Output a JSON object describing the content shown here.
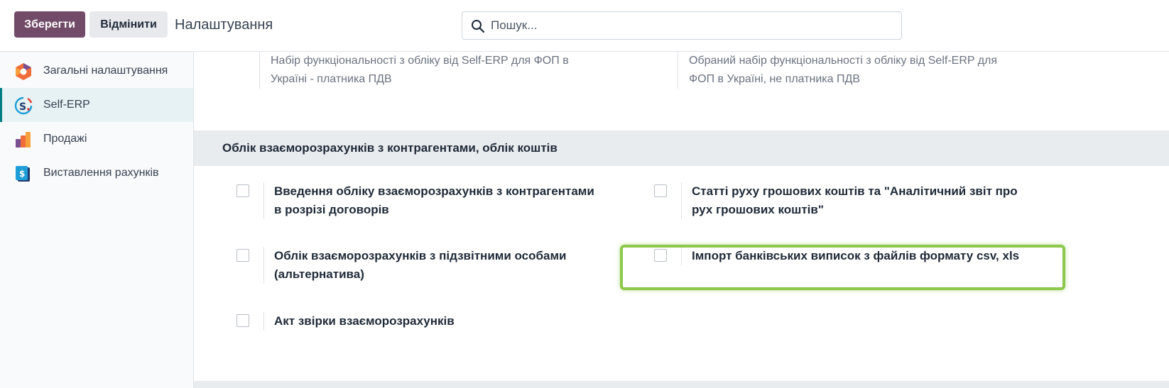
{
  "toolbar": {
    "save_label": "Зберегти",
    "discard_label": "Відмінити",
    "title": "Налаштування"
  },
  "search": {
    "placeholder": "Пошук...",
    "value": "",
    "icon": "search-icon"
  },
  "sidebar": {
    "items": [
      {
        "label": "Загальні налаштування",
        "icon": "general-settings-icon",
        "active": false
      },
      {
        "label": "Self-ERP",
        "icon": "self-erp-icon",
        "active": true
      },
      {
        "label": "Продажі",
        "icon": "sales-icon",
        "active": false
      },
      {
        "label": "Виставлення рахунків",
        "icon": "invoicing-icon",
        "active": false
      }
    ]
  },
  "main": {
    "top_descriptions": [
      "Набір функціональності з обліку від Self-ERP для ФОП в Україні - платника ПДВ",
      "Обраний набір функціональності з обліку від Self-ERP для ФОП в Україні, не платника ПДВ"
    ],
    "section": {
      "title": "Облік взаєморозрахунків з контрагентами, облік коштів",
      "options": [
        {
          "label": "Введення обліку взаєморозрахунків з контрагентами в розрізі договорів",
          "checked": false
        },
        {
          "label": "Статті руху грошових коштів та \"Аналітичний звіт про рух грошових коштів\"",
          "checked": false
        },
        {
          "label": "Облік взаєморозрахунків з підзвітними особами (альтернатива)",
          "checked": false
        },
        {
          "label": "Імпорт банківських виписок з файлів формату csv, xls",
          "checked": false,
          "highlighted": true
        },
        {
          "label": "Акт звірки взаєморозрахунків",
          "checked": false
        }
      ]
    }
  },
  "colors": {
    "primary": "#714B67",
    "active_accent": "#017e84",
    "highlight": "#8cc84b"
  }
}
